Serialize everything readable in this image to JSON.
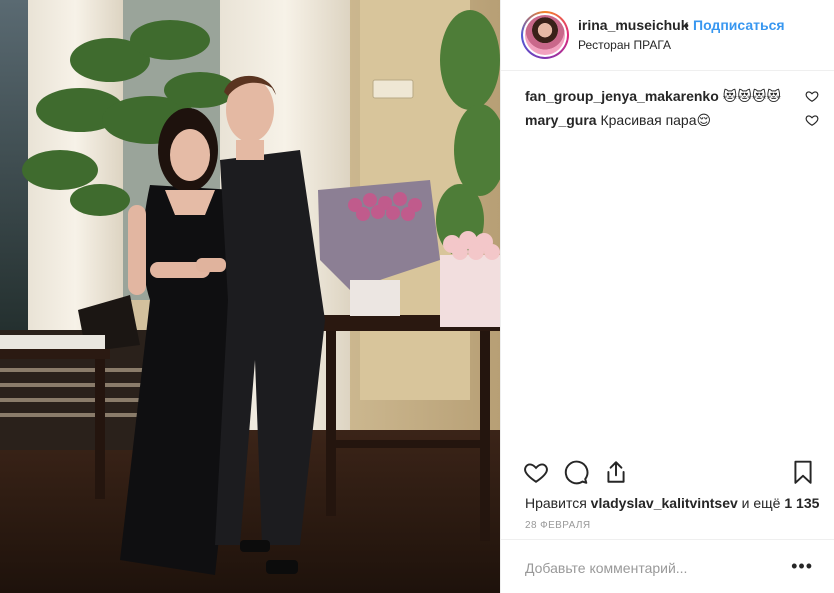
{
  "post": {
    "image_alt": "Пара в ресторане"
  },
  "header": {
    "username": "irina_museichuk",
    "separator": "•",
    "follow_label": "Подписаться",
    "location": "Ресторан ПРАГА"
  },
  "comments": [
    {
      "user": "fan_group_jenya_makarenko",
      "text": "😻😻😻😻"
    },
    {
      "user": "mary_gura",
      "text": "Красивая пара😌"
    }
  ],
  "likes": {
    "prefix": "Нравится",
    "user": "vladyslav_kalitvintsev",
    "suffix": "и ещё",
    "count": "1 135"
  },
  "date": "28 ФЕВРАЛЯ",
  "add_comment": {
    "placeholder": "Добавьте комментарий...",
    "more_label": "•••"
  },
  "icons": {
    "like": "heart-icon",
    "comment": "comment-icon",
    "share": "share-icon",
    "save": "bookmark-icon",
    "comment_like": "heart-icon"
  },
  "colors": {
    "accent": "#3897f0",
    "text": "#262626",
    "muted": "#999999",
    "divider": "#efefef"
  }
}
